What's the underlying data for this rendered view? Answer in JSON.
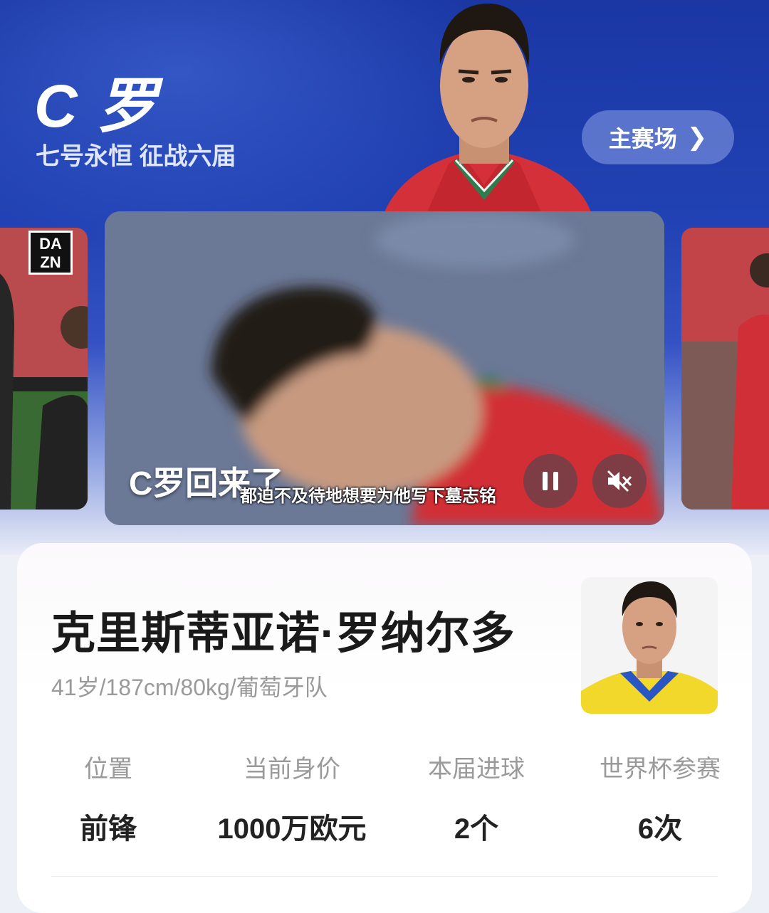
{
  "hero": {
    "title": "C 罗",
    "subtitle": "七号永恒 征战六届",
    "main_button": "主赛场"
  },
  "video": {
    "title": "C罗回来了",
    "caption": "都迫不及待地想要为他写下墓志铭",
    "side_left_logo": "DA ZN"
  },
  "player": {
    "name": "克里斯蒂亚诺·罗纳尔多",
    "meta": "41岁/187cm/80kg/葡萄牙队",
    "stats": [
      {
        "label": "位置",
        "value": "前锋"
      },
      {
        "label": "当前身价",
        "value": "1000万欧元"
      },
      {
        "label": "本届进球",
        "value": "2个"
      },
      {
        "label": "世界杯参赛",
        "value": "6次"
      }
    ]
  },
  "colors": {
    "hero_blue": "#1a37a4",
    "jersey_red": "#d9303a",
    "jersey_yellow": "#f2d82b"
  }
}
